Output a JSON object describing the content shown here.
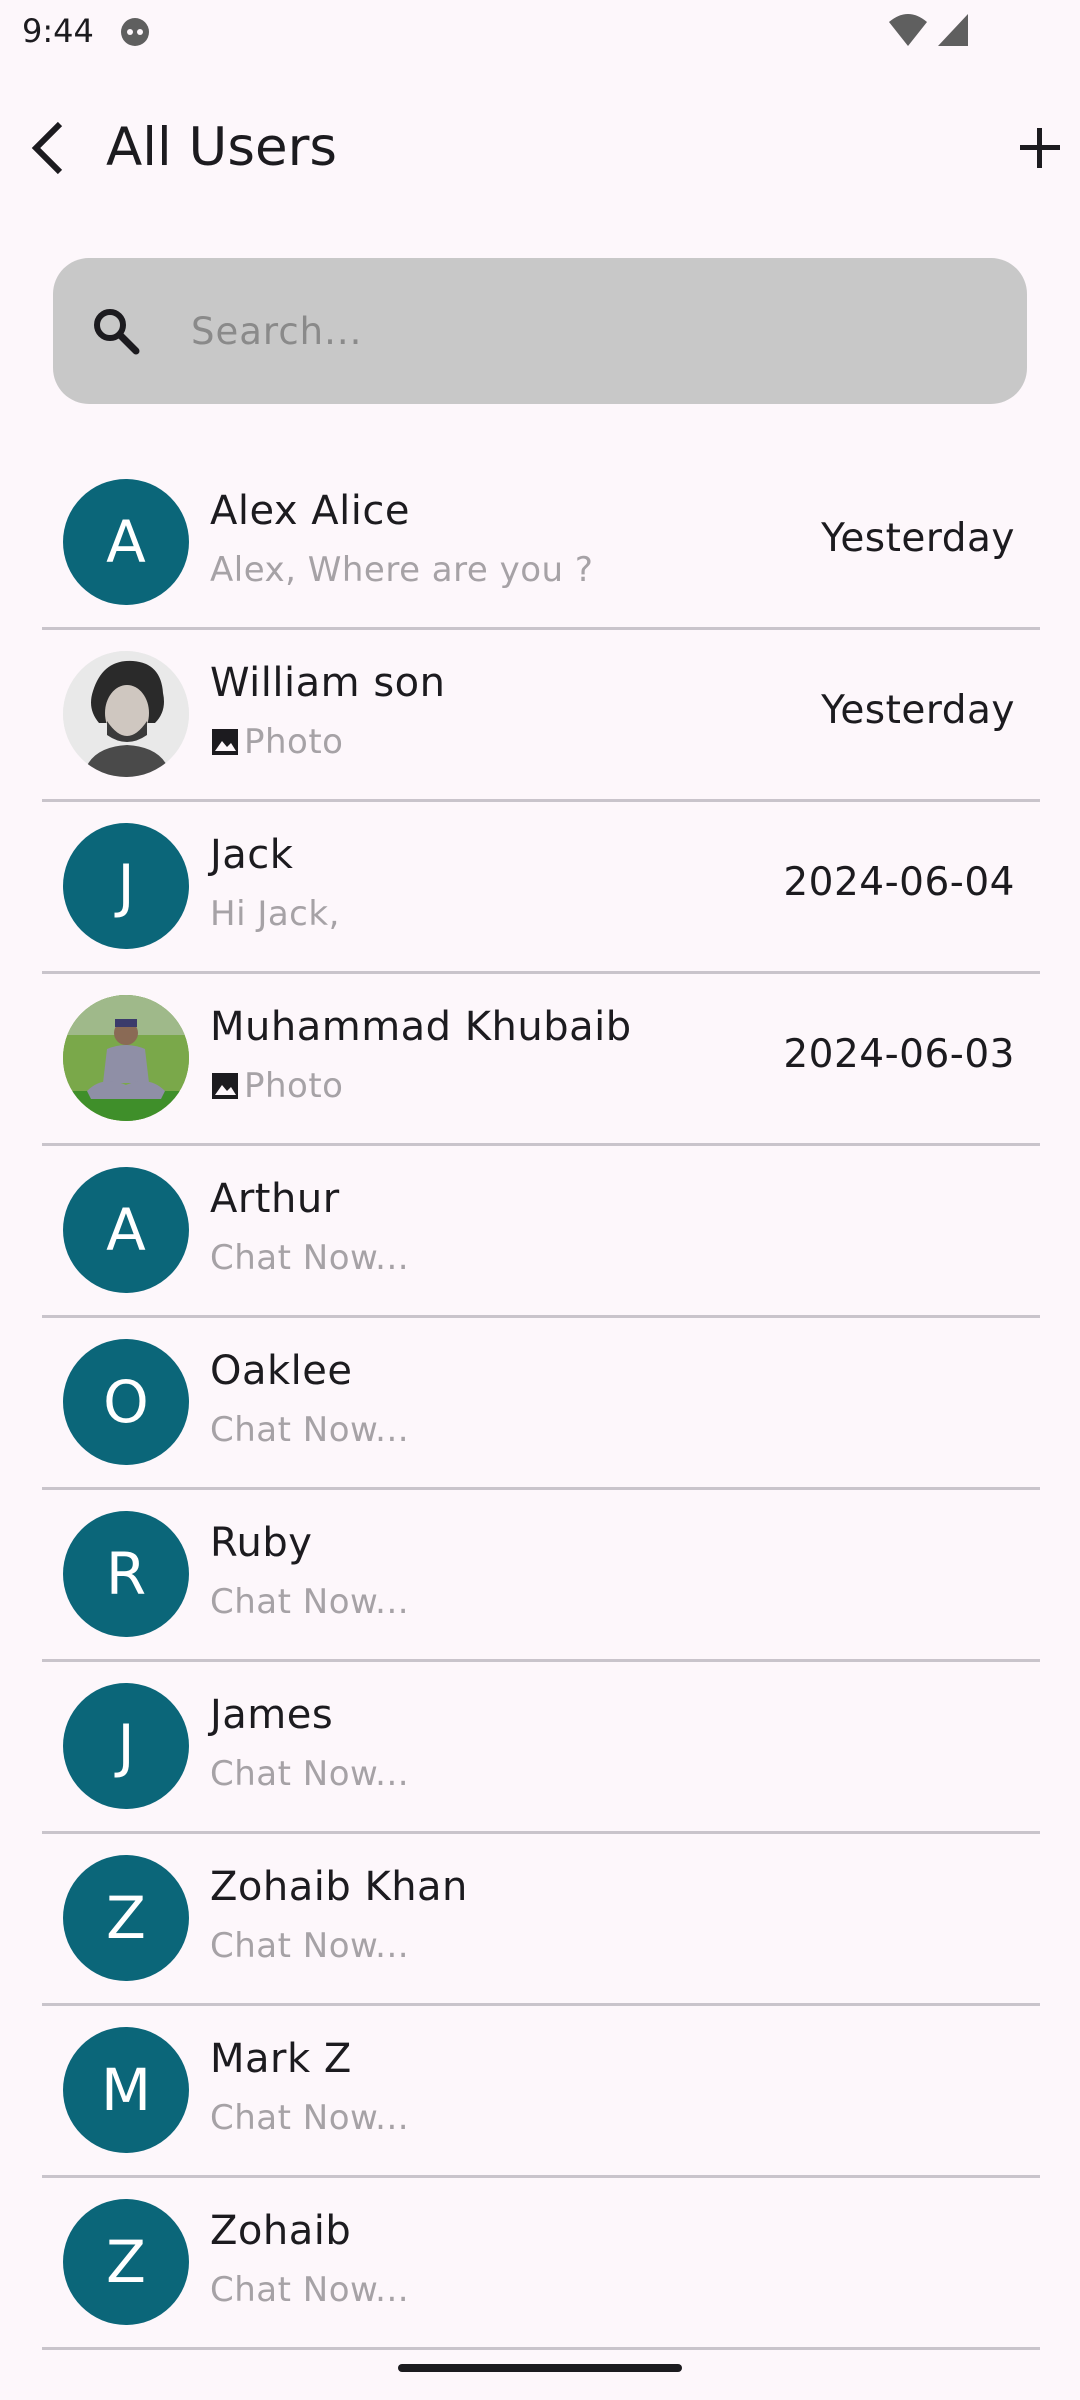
{
  "status_bar": {
    "time": "9:44",
    "icons": [
      "face-notification-icon",
      "wifi-icon",
      "signal-icon"
    ]
  },
  "header": {
    "title": "All Users",
    "back_icon": "arrow-back-icon",
    "add_icon": "plus-icon"
  },
  "search": {
    "placeholder": "Search...",
    "value": "",
    "icon": "search-icon"
  },
  "colors": {
    "background": "#fdf7fb",
    "avatar_bg": "#0b6679",
    "search_bg": "#c8c8c8",
    "preview_text": "#a6a2a6",
    "divider": "#c9c4cb"
  },
  "chats": [
    {
      "name": "Alex Alice",
      "initial": "A",
      "preview": "Alex, Where are you ?",
      "time": "Yesterday"
    },
    {
      "name": "William son",
      "initial": "",
      "preview": "Photo",
      "time": "Yesterday"
    },
    {
      "name": "Jack",
      "initial": "J",
      "preview": "Hi Jack,",
      "time": "2024-06-04"
    },
    {
      "name": "Muhammad Khubaib",
      "initial": "",
      "preview": "Photo",
      "time": "2024-06-03"
    },
    {
      "name": "Arthur",
      "initial": "A",
      "preview": "Chat Now...",
      "time": ""
    },
    {
      "name": "Oaklee",
      "initial": "O",
      "preview": "Chat Now...",
      "time": ""
    },
    {
      "name": "Ruby",
      "initial": "R",
      "preview": "Chat Now...",
      "time": ""
    },
    {
      "name": "James",
      "initial": "J",
      "preview": "Chat Now...",
      "time": ""
    },
    {
      "name": "Zohaib Khan",
      "initial": "Z",
      "preview": "Chat Now...",
      "time": ""
    },
    {
      "name": "Mark Z",
      "initial": "M",
      "preview": "Chat Now...",
      "time": ""
    },
    {
      "name": "Zohaib",
      "initial": "Z",
      "preview": "Chat Now...",
      "time": ""
    }
  ]
}
